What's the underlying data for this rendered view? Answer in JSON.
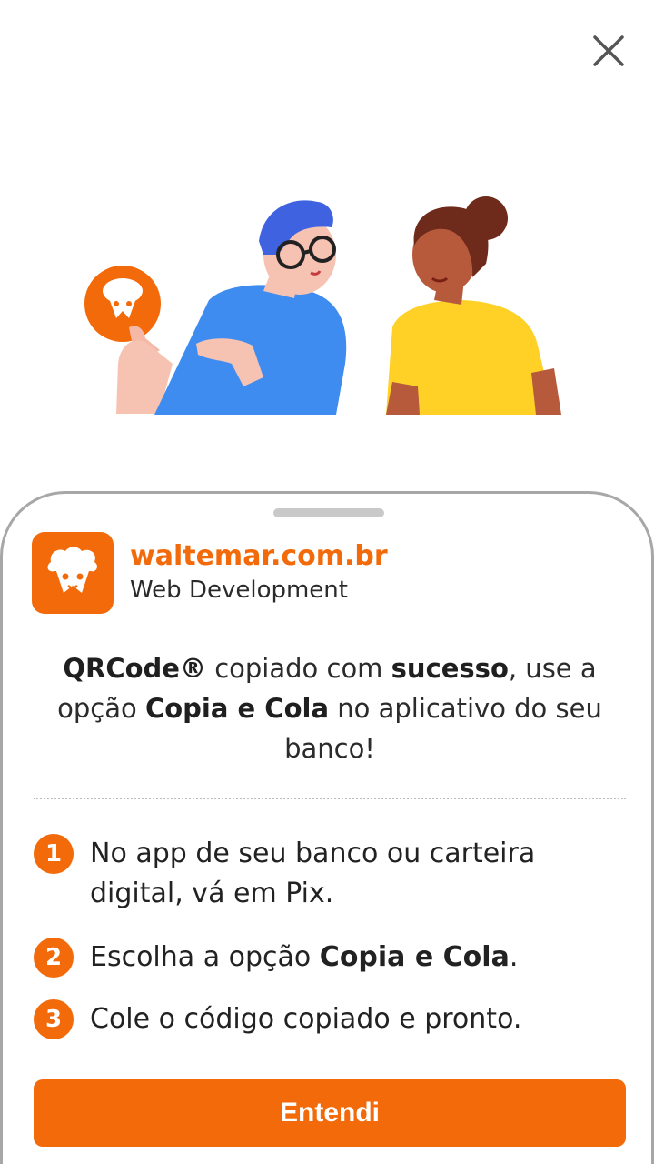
{
  "close": {
    "icon": "close-icon"
  },
  "illustration": {
    "icon": "people-illustration"
  },
  "merchant": {
    "name": "waltemar.com.br",
    "subtitle": "Web Development",
    "logo_icon": "sheep-logo-icon"
  },
  "message": {
    "part1": "QRCode®",
    "part2": " copiado com ",
    "part3": "sucesso",
    "part4": ", use a opção ",
    "part5": "Copia e Cola",
    "part6": " no aplicativo do seu banco!"
  },
  "steps": [
    {
      "number": "1",
      "text": "No app de seu banco ou carteira digital, vá em Pix."
    },
    {
      "number": "2",
      "text_before": "Escolha a opção ",
      "text_bold": "Copia e Cola",
      "text_after": "."
    },
    {
      "number": "3",
      "text": "Cole o código copiado e pronto."
    }
  ],
  "button": {
    "label": "Entendi"
  },
  "colors": {
    "accent": "#f26a0a",
    "text": "#222222",
    "border": "#a7a7a7"
  }
}
